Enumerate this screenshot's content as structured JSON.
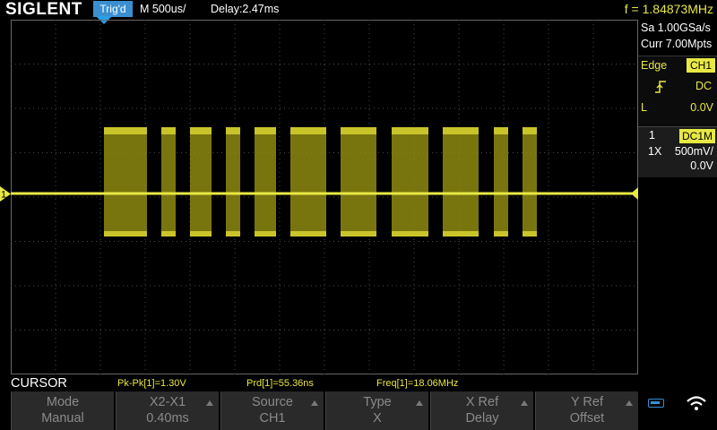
{
  "brand": "SIGLENT",
  "acquisition": {
    "trigger_status": "Trig'd",
    "timebase": "M 500us/",
    "delay": "Delay:2.47ms",
    "frequency": "f = 1.84873MHz"
  },
  "right_panel": {
    "sample_rate": "Sa 1.00GSa/s",
    "memory_depth": "Curr 7.00Mpts",
    "trigger": {
      "type": "Edge",
      "source": "CH1",
      "slope_icon": "rising-edge-icon",
      "coupling": "DC",
      "level_label": "L",
      "level": "0.0V"
    },
    "channel1": {
      "number": "1",
      "coupling": "DC1M",
      "probe": "1X",
      "scale": "500mV/",
      "offset": "0.0V"
    }
  },
  "waveform": {
    "channel_marker": "1",
    "color": "#e8e844"
  },
  "cursor_bar": {
    "menu_title": "CURSOR",
    "pkpk": "Pk-Pk[1]=1.30V",
    "period": "Prd[1]=55.36ns",
    "frequency": "Freq[1]=18.06MHz"
  },
  "softkeys": {
    "mode": {
      "title": "Mode",
      "value": "Manual"
    },
    "x2x1": {
      "title": "X2-X1",
      "value": "0.40ms"
    },
    "source": {
      "title": "Source",
      "value": "CH1"
    },
    "type": {
      "title": "Type",
      "value": "X"
    },
    "xref": {
      "title": "X Ref",
      "value": "Delay"
    },
    "yref": {
      "title": "Y Ref",
      "value": "Offset"
    }
  },
  "status_icons": {
    "usb": "usb-icon",
    "wifi": "wifi-icon"
  },
  "colors": {
    "trace": "#e8e844",
    "trigger_badge": "#3a8fd0",
    "grid": "#555555"
  }
}
